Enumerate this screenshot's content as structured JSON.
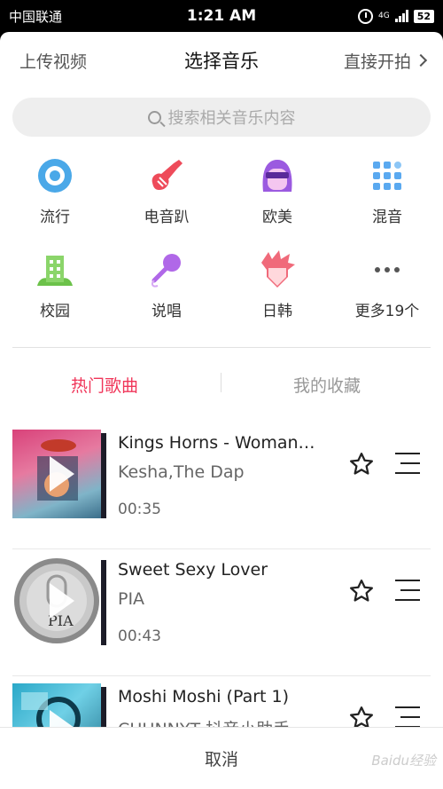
{
  "status_bar": {
    "carrier": "中国联通",
    "time": "1:21 AM",
    "network": "4G",
    "battery": "52"
  },
  "nav": {
    "left_label": "上传视频",
    "title": "选择音乐",
    "right_label": "直接开拍"
  },
  "search": {
    "placeholder": "搜索相关音乐内容"
  },
  "categories": [
    {
      "label": "流行",
      "icon": "disc-icon",
      "color": "#4aa8e8"
    },
    {
      "label": "电音趴",
      "icon": "guitar-icon",
      "color": "#ee4b5a"
    },
    {
      "label": "欧美",
      "icon": "sunglasses-girl-icon",
      "color": "#9b5ae0"
    },
    {
      "label": "混音",
      "icon": "grid-dots-icon",
      "color": "#5aa9f0"
    },
    {
      "label": "校园",
      "icon": "school-building-icon",
      "color": "#6cc24a"
    },
    {
      "label": "说唱",
      "icon": "microphone-icon",
      "color": "#b068e8"
    },
    {
      "label": "日韩",
      "icon": "anime-boy-icon",
      "color": "#f06a7a"
    },
    {
      "label": "更多19个",
      "icon": "more-icon",
      "color": "#555555"
    }
  ],
  "tabs": [
    {
      "label": "热门歌曲",
      "active": true
    },
    {
      "label": "我的收藏",
      "active": false
    }
  ],
  "songs": [
    {
      "title": "Kings Horns - Woman…",
      "artist": "Kesha,The Dap",
      "duration": "00:35"
    },
    {
      "title": "Sweet Sexy Lover",
      "artist": "PIA",
      "duration": "00:43"
    },
    {
      "title": "Moshi Moshi (Part 1)",
      "artist": "CHUNNYT,抖音小助手",
      "duration": ""
    }
  ],
  "footer": {
    "cancel_label": "取消"
  },
  "watermark": "Baidu经验",
  "colors": {
    "accent": "#f0365a",
    "inactive_tab": "#999999"
  }
}
